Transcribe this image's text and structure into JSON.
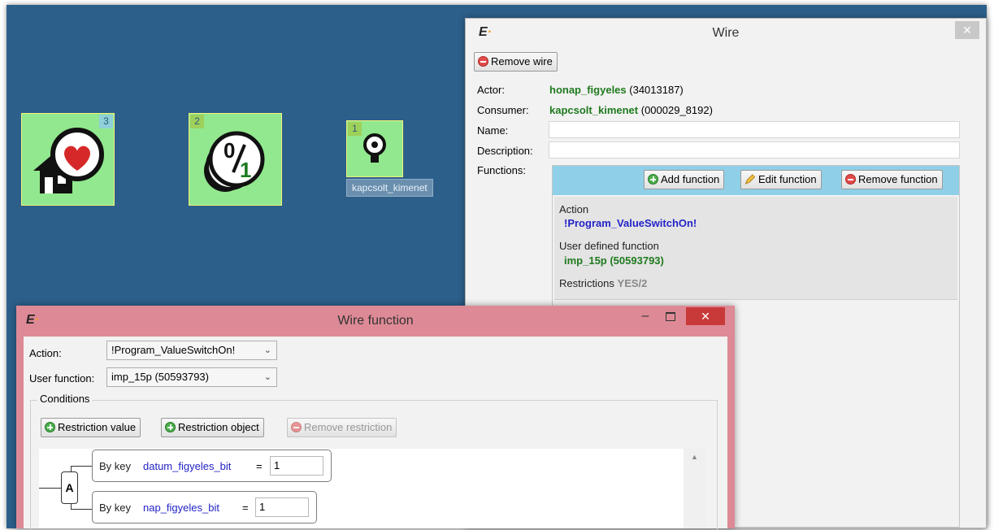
{
  "workspace": {
    "nodes": [
      {
        "badge": "3",
        "icon": "home-heart-icon"
      },
      {
        "badge": "2",
        "icon": "toggle-zero-one-icon"
      },
      {
        "badge": "1",
        "icon": "output-bulb-icon",
        "label": "kapcsolt_kimenet"
      }
    ]
  },
  "wire_window": {
    "title": "Wire",
    "close_glyph": "✕",
    "remove_wire_label": "Remove wire",
    "actor_label": "Actor:",
    "actor_name": "honap_figyeles",
    "actor_id": "(34013187)",
    "consumer_label": "Consumer:",
    "consumer_name": "kapcsolt_kimenet",
    "consumer_id": "(000029_8192)",
    "name_label": "Name:",
    "description_label": "Description:",
    "functions_label": "Functions:",
    "add_function_label": "Add function",
    "edit_function_label": "Edit function",
    "remove_function_label": "Remove function",
    "function_item": {
      "action_heading": "Action",
      "action_value": "!Program_ValueSwitchOn!",
      "udf_heading": "User defined function",
      "udf_value": "imp_15p (50593793)",
      "restrictions_heading": "Restrictions",
      "restrictions_value": "YES/2"
    }
  },
  "wire_function_window": {
    "title": "Wire function",
    "minimize_glyph": "–",
    "close_glyph": "✕",
    "action_label": "Action:",
    "action_value": "!Program_ValueSwitchOn!",
    "user_function_label": "User function:",
    "user_function_value": "imp_15p (50593793)",
    "conditions_label": "Conditions",
    "restriction_value_label": "Restriction value",
    "restriction_object_label": "Restriction object",
    "remove_restriction_label": "Remove restriction",
    "operator": "A",
    "conditions": [
      {
        "by": "By key",
        "key": "datum_figyeles_bit",
        "op": "=",
        "value": "1"
      },
      {
        "by": "By key",
        "key": "nap_figyeles_bit",
        "op": "=",
        "value": "1"
      }
    ]
  },
  "colors": {
    "workspace_bg": "#2c5f8a",
    "node_bg": "#92e88e",
    "wire_function_frame": "#de8a96",
    "functions_toolbar": "#8fd0e8",
    "value_green": "#1f7a1f",
    "value_blue": "#2323c8"
  }
}
